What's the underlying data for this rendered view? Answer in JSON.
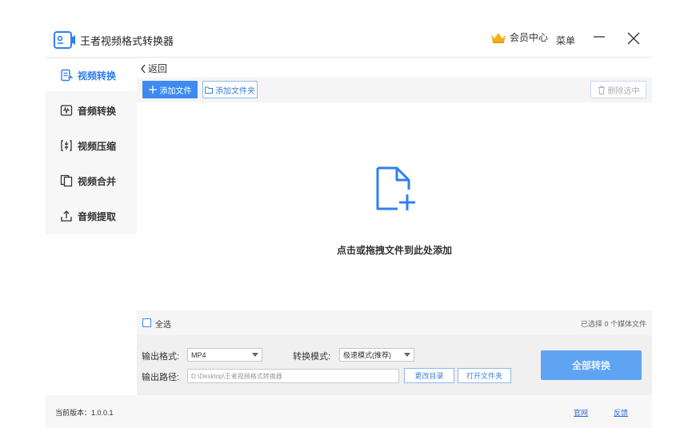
{
  "app": {
    "title": "王者视频格式转换器"
  },
  "header": {
    "member_label": "会员中心",
    "menu_label": "菜单"
  },
  "sidebar": {
    "items": [
      {
        "label": "视频转换",
        "icon": "video-convert-icon",
        "active": true
      },
      {
        "label": "音频转换",
        "icon": "audio-convert-icon",
        "active": false
      },
      {
        "label": "视频压缩",
        "icon": "video-compress-icon",
        "active": false
      },
      {
        "label": "视频合并",
        "icon": "video-merge-icon",
        "active": false
      },
      {
        "label": "音频提取",
        "icon": "audio-extract-icon",
        "active": false
      }
    ]
  },
  "main": {
    "back_label": "返回",
    "toolbar": {
      "add_file": "添加文件",
      "add_folder": "添加文件夹",
      "delete_selected": "删除选中"
    },
    "dropzone_text": "点击或拖拽文件到此处添加",
    "select_all_label": "全选",
    "selected_count_text": "已选择 0 个媒体文件"
  },
  "settings": {
    "output_format_label": "输出格式:",
    "output_format_value": "MP4",
    "convert_mode_label": "转换模式:",
    "convert_mode_value": "极速模式(推荐)",
    "output_path_label": "输出路径:",
    "output_path_value": "D:\\Desktop\\王者视频格式转换器",
    "change_dir_label": "更改目录",
    "open_folder_label": "打开文件夹",
    "convert_all_label": "全部转换"
  },
  "footer": {
    "version_text": "当前版本：1.0.0.1",
    "website_link": "官网",
    "feedback_link": "反馈"
  },
  "colors": {
    "accent": "#3d8bf0",
    "convert_button": "#5ea4f3",
    "crown": "#f2b21c"
  }
}
